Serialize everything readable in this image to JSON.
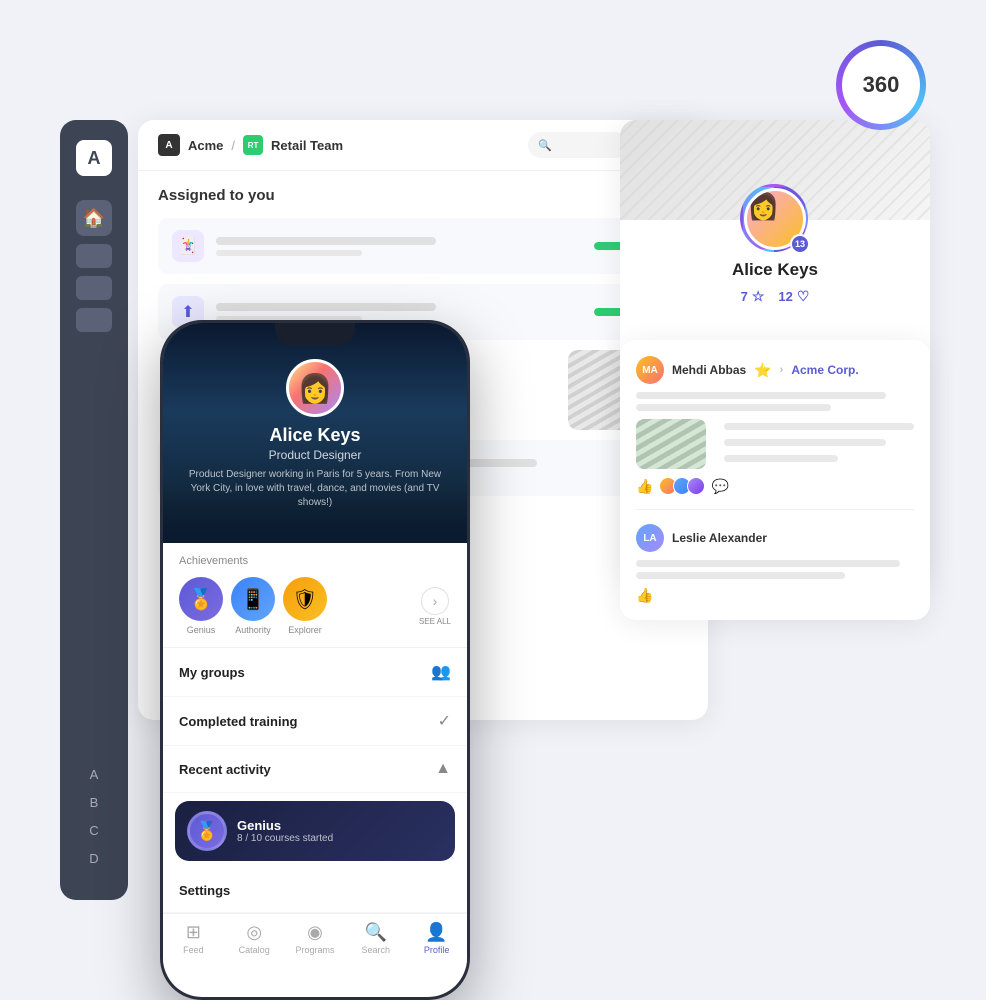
{
  "badge360": {
    "value": "360"
  },
  "sidebar": {
    "logo": "A",
    "letters": [
      "A",
      "B",
      "C",
      "D"
    ]
  },
  "appHeader": {
    "logoText": "A",
    "brand": "Acme",
    "separator": "/",
    "teamBadge": "RT",
    "teamName": "Retail Team",
    "searchPlaceholder": ""
  },
  "assignedSection": {
    "title": "Assigned to you"
  },
  "profilePanel": {
    "name": "Alice Keys",
    "stat1Value": "7",
    "stat1Icon": "☆",
    "stat2Value": "12",
    "stat2Icon": "♡",
    "badgeCount": "13"
  },
  "feedPanel": {
    "item1": {
      "username": "Mehdi Abbas",
      "badge": "⭐",
      "arrow": "›",
      "company": "Acme Corp."
    },
    "item2": {
      "username": "Leslie Alexander"
    }
  },
  "phone": {
    "heroName": "Alice Keys",
    "heroTitle": "Product Designer",
    "heroBio": "Product Designer working in Paris for 5 years. From New York City, in love with travel, dance, and movies (and TV shows!)",
    "achievementsTitle": "Achievements",
    "achievements": [
      {
        "label": "Genius",
        "emoji": "🏅"
      },
      {
        "label": "Authority",
        "emoji": "📱"
      },
      {
        "label": "Explorer",
        "emoji": "🛡"
      }
    ],
    "seeAll": "SEE ALL",
    "menuItems": [
      {
        "label": "My groups",
        "icon": "👥"
      },
      {
        "label": "Completed training",
        "icon": "✓"
      },
      {
        "label": "Recent activity",
        "icon": "▲"
      },
      {
        "label": "Settings",
        "icon": ""
      }
    ],
    "activityBanner": {
      "title": "Genius",
      "sub": "8 / 10 courses started"
    },
    "nav": [
      {
        "label": "Feed",
        "icon": "⊞",
        "active": false
      },
      {
        "label": "Catalog",
        "icon": "◎",
        "active": false
      },
      {
        "label": "Programs",
        "icon": "◉",
        "active": false
      },
      {
        "label": "Search",
        "icon": "🔍",
        "active": false
      },
      {
        "label": "Profile",
        "icon": "👤",
        "active": true
      }
    ]
  }
}
